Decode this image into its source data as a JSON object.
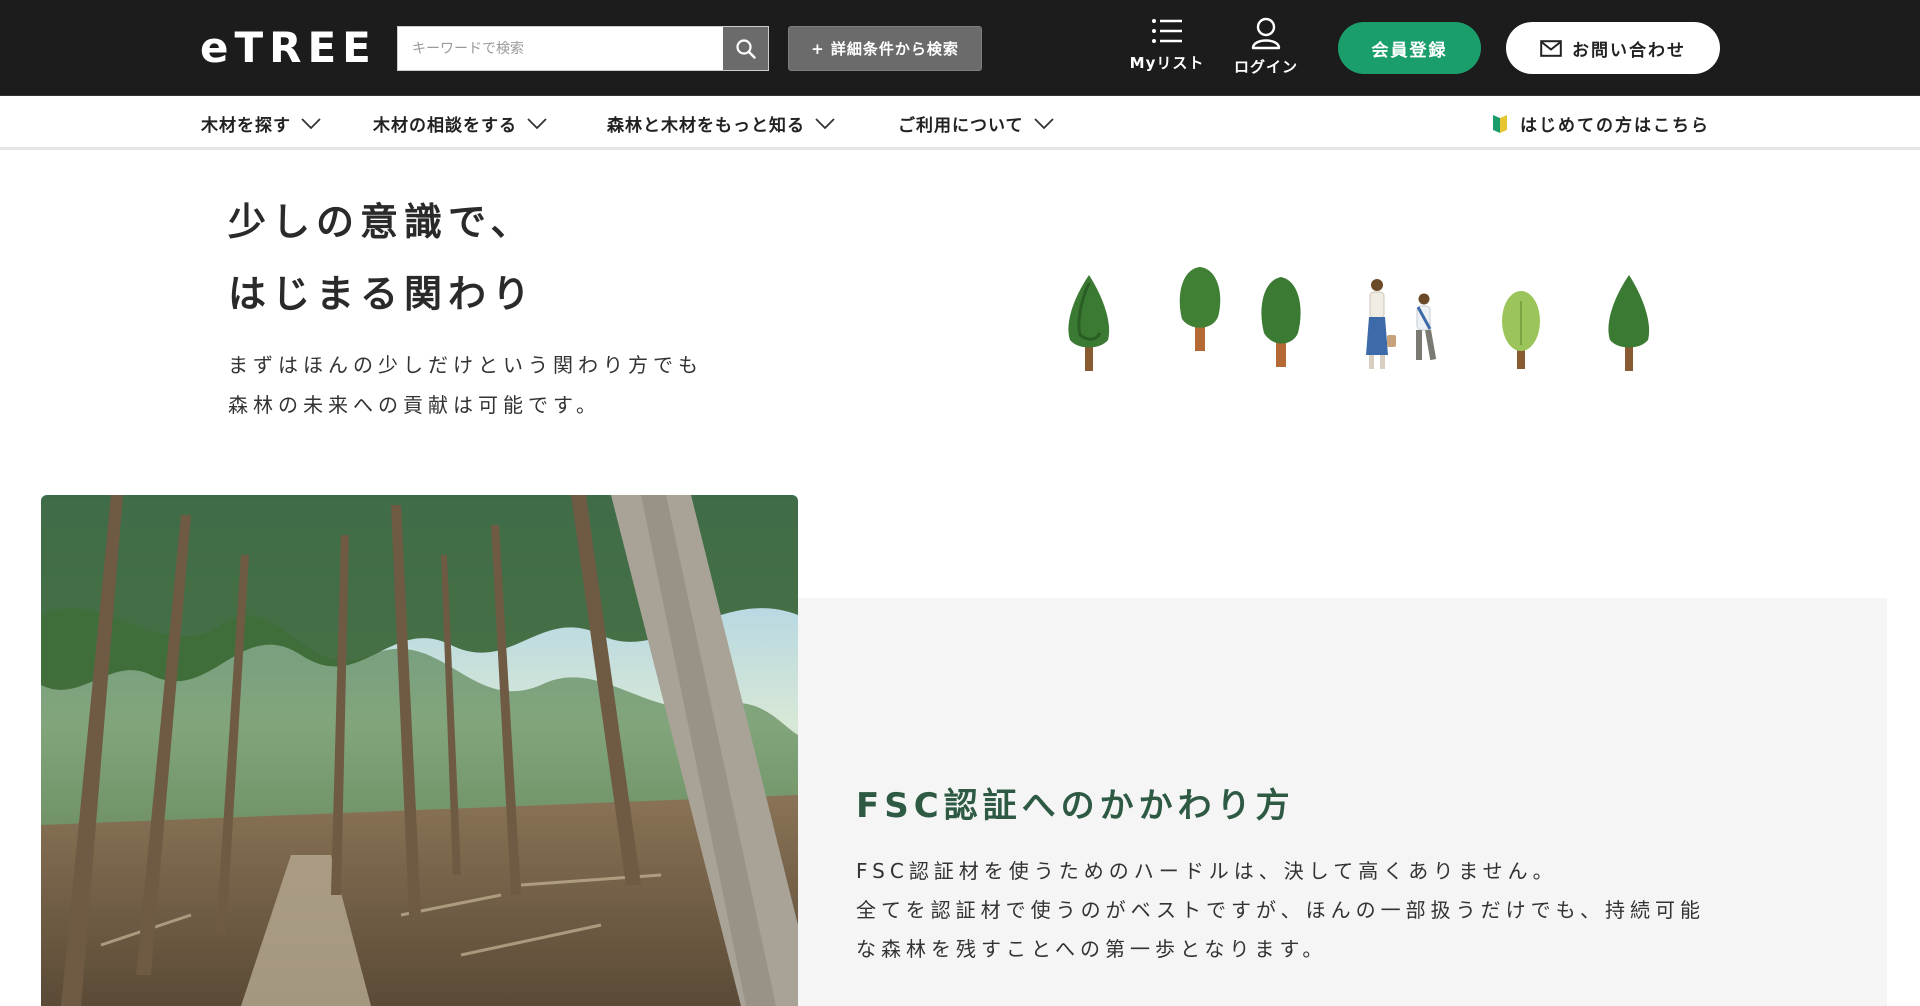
{
  "header": {
    "logo": "eTREE",
    "search": {
      "placeholder": "キーワードで検索",
      "value": ""
    },
    "advanced_search_label": "+ 詳細条件から検索",
    "mylist_label": "Myリスト",
    "login_label": "ログイン",
    "register_label": "会員登録",
    "contact_label": "お問い合わせ"
  },
  "nav": {
    "items": [
      {
        "label": "木材を探す"
      },
      {
        "label": "木材の相談をする"
      },
      {
        "label": "森林と木材をもっと知る"
      },
      {
        "label": "ご利用について"
      }
    ],
    "beginner_label": "はじめての方はこちら"
  },
  "hero": {
    "title_lines": [
      "少しの意識で、",
      "はじまる関わり"
    ],
    "desc_lines": [
      "まずはほんの少しだけという関わり方でも",
      "森林の未来への貢献は可能です。"
    ]
  },
  "fsc": {
    "title": "FSC認証へのかかわり方",
    "body_lines": [
      "FSC認証材を使うためのハードルは、決して高くありません。",
      "全てを認証材で使うのがベストですが、ほんの一部扱うだけでも、持続可能",
      "な森林を残すことへの第一歩となります。"
    ]
  },
  "colors": {
    "header_bg": "#1c1c1c",
    "accent_green": "#1a9e6b",
    "title_green": "#2e5a44",
    "card_bg": "#f6f5f5"
  }
}
